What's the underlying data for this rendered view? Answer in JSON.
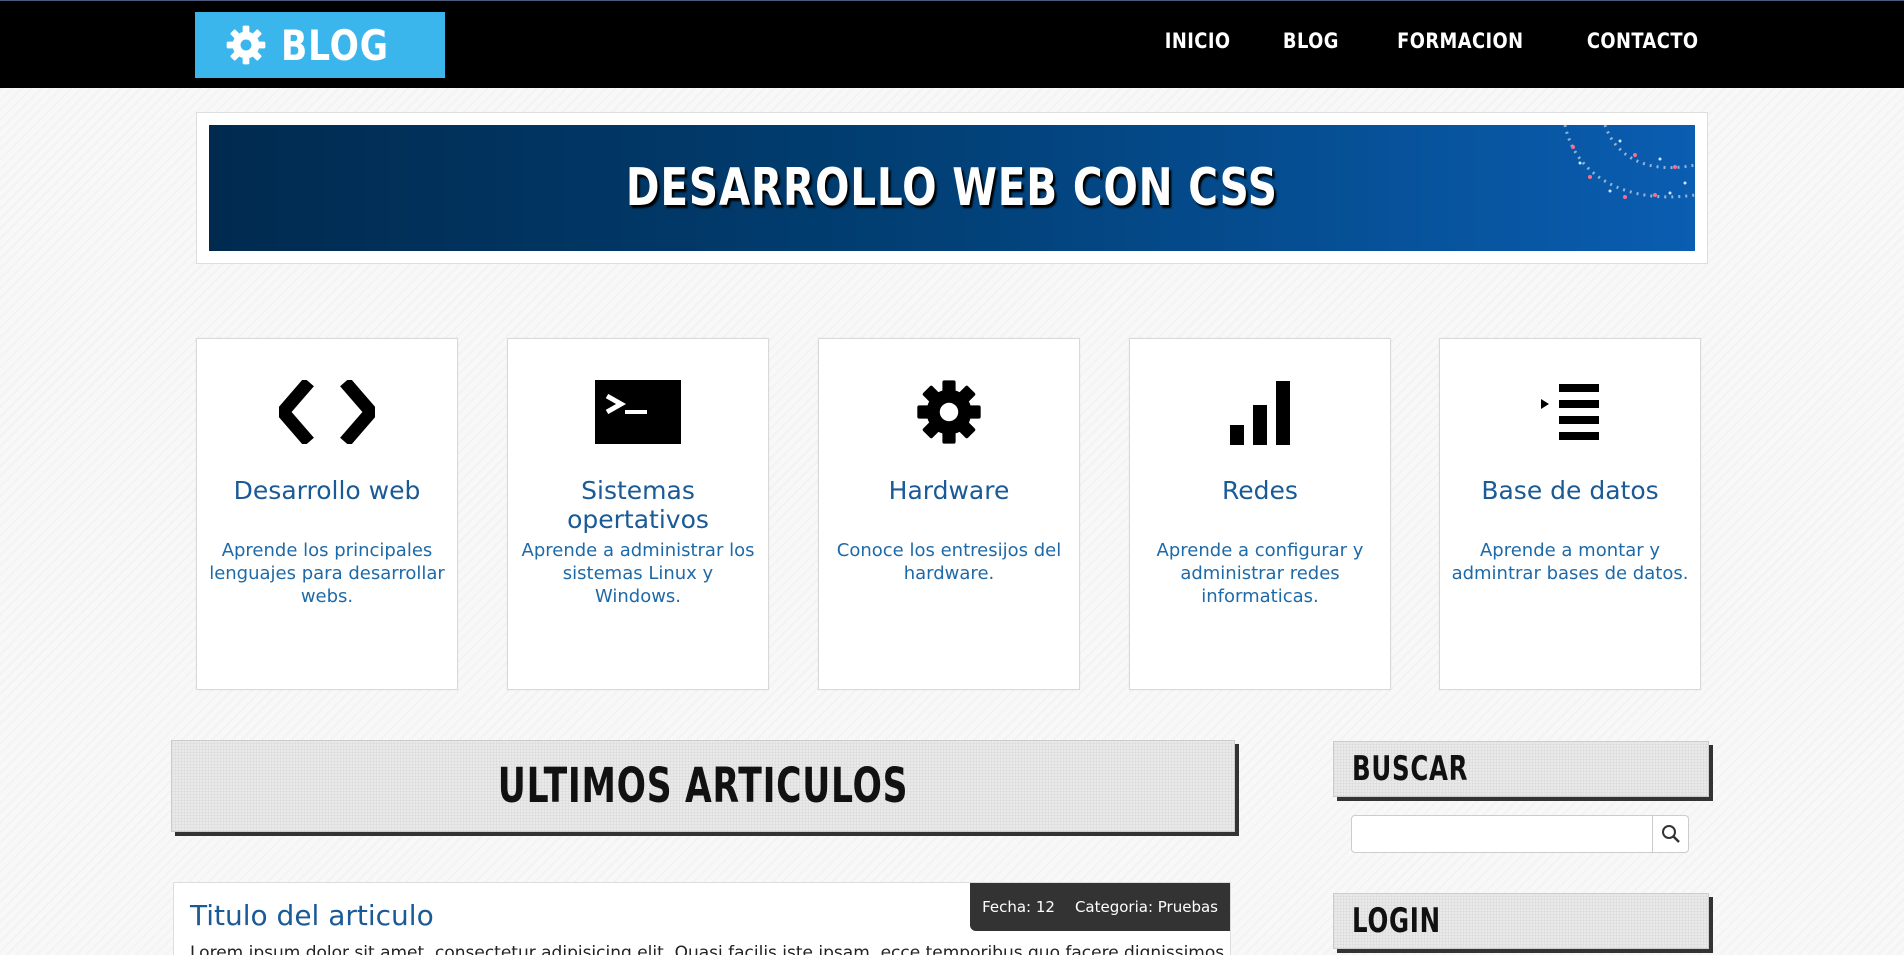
{
  "header": {
    "logo_text": "BLOG",
    "nav": [
      "INICIO",
      "BLOG",
      "FORMACION",
      "CONTACTO"
    ]
  },
  "banner": {
    "title": "DESARROLLO WEB CON CSS"
  },
  "cards": [
    {
      "icon": "code-icon",
      "title": "Desarrollo web",
      "desc": "Aprende los principales lenguajes para desarrollar webs."
    },
    {
      "icon": "terminal-icon",
      "title": "Sistemas opertativos",
      "desc": "Aprende a administrar los sistemas Linux y Windows."
    },
    {
      "icon": "gear-icon",
      "title": "Hardware",
      "desc": "Conoce los entresijos del hardware."
    },
    {
      "icon": "signal-bars-icon",
      "title": "Redes",
      "desc": "Aprende a configurar y administrar redes informaticas."
    },
    {
      "icon": "list-indent-icon",
      "title": "Base de datos",
      "desc": "Aprende a montar y admintrar bases de datos."
    }
  ],
  "latest": {
    "title": "ULTIMOS ARTICULOS"
  },
  "sidebar": {
    "search_title": "BUSCAR",
    "search_placeholder": "",
    "login_title": "LOGIN"
  },
  "article": {
    "title": "Titulo del articulo",
    "date": "Fecha: 12",
    "category": "Categoria: Pruebas",
    "excerpt": "Lorem ipsum dolor sit amet, consectetur adipisicing elit. Quasi facilis iste ipsam, ecce temporibus quo facere dignissimos ratione"
  },
  "colors": {
    "accent": "#3bb6ec",
    "link": "#1a5a97",
    "header_bg": "#000000"
  }
}
